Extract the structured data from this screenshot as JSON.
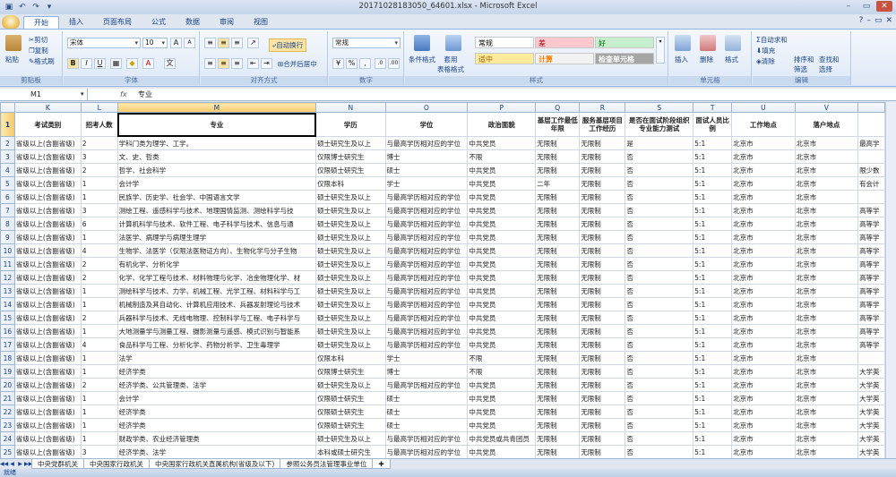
{
  "window": {
    "title": "20171028183050_64601.xlsx - Microsoft Excel"
  },
  "ribbon_tabs": [
    "开始",
    "插入",
    "页面布局",
    "公式",
    "数据",
    "审阅",
    "视图"
  ],
  "ribbon": {
    "clipboard": {
      "paste": "粘贴",
      "cut": "剪切",
      "copy": "复制",
      "format_painter": "格式刷",
      "label": "剪贴板"
    },
    "font": {
      "name": "宋体",
      "size": "10",
      "label": "字体"
    },
    "alignment": {
      "wrap": "自动换行",
      "merge": "合并后居中",
      "label": "对齐方式"
    },
    "number": {
      "format": "常规",
      "label": "数字"
    },
    "styles": {
      "conditional": "条件格式",
      "table_format": "套用\n表格格式",
      "boxes": [
        {
          "text": "常规",
          "bg": "#ffffff",
          "color": "#000000"
        },
        {
          "text": "差",
          "bg": "#ffc7ce",
          "color": "#9c0006"
        },
        {
          "text": "好",
          "bg": "#c6efce",
          "color": "#006100"
        },
        {
          "text": "适中",
          "bg": "#ffeb9c",
          "color": "#9c6500"
        },
        {
          "text": "计算",
          "bg": "#f2f2f2",
          "color": "#fa7d00"
        },
        {
          "text": "检查单元格",
          "bg": "#a5a5a5",
          "color": "#ffffff"
        }
      ],
      "label": "样式"
    },
    "cells": {
      "insert": "插入",
      "delete": "删除",
      "format": "格式",
      "label": "单元格"
    },
    "editing": {
      "autosum": "自动求和",
      "fill": "填充",
      "clear": "清除",
      "sort": "排序和\n筛选",
      "find": "查找和\n选择",
      "label": "编辑"
    }
  },
  "formula_bar": {
    "namebox": "M1",
    "fx": "fx",
    "content": "专业"
  },
  "columns": [
    "K",
    "L",
    "M",
    "N",
    "O",
    "P",
    "Q",
    "R",
    "S",
    "T",
    "U",
    "V",
    ""
  ],
  "header_row": [
    "考试类别",
    "招考人数",
    "专业",
    "学历",
    "学位",
    "政治面貌",
    "基层工作最低年限",
    "服务基层项目工作经历",
    "是否在面试阶段组织专业能力测试",
    "面试人员比例",
    "工作地点",
    "落户地点",
    ""
  ],
  "rows": [
    {
      "n": "2",
      "cells": [
        "省级以上(含副省级)",
        "2",
        "学科门类为理学、工学。",
        "硕士研究生及以上",
        "与最高学历相对应的学位",
        "中共党员",
        "无限制",
        "无限制",
        "是",
        "5:1",
        "北京市",
        "北京市",
        "最高学"
      ]
    },
    {
      "n": "3",
      "cells": [
        "省级以上(含副省级)",
        "3",
        "文、史、哲类",
        "仅限博士研究生",
        "博士",
        "不限",
        "无限制",
        "无限制",
        "否",
        "5:1",
        "北京市",
        "北京市",
        ""
      ]
    },
    {
      "n": "4",
      "cells": [
        "省级以上(含副省级)",
        "2",
        "哲学、社会科学",
        "仅限硕士研究生",
        "硕士",
        "中共党员",
        "无限制",
        "无限制",
        "否",
        "5:1",
        "北京市",
        "北京市",
        "限少数"
      ]
    },
    {
      "n": "5",
      "cells": [
        "省级以上(含副省级)",
        "1",
        "会计学",
        "仅限本科",
        "学士",
        "中共党员",
        "二年",
        "无限制",
        "否",
        "5:1",
        "北京市",
        "北京市",
        "有会计"
      ]
    },
    {
      "n": "6",
      "cells": [
        "省级以上(含副省级)",
        "1",
        "民族学、历史学、社会学、中国语言文学",
        "硕士研究生及以上",
        "与最高学历相对应的学位",
        "中共党员",
        "无限制",
        "无限制",
        "否",
        "5:1",
        "北京市",
        "北京市",
        ""
      ]
    },
    {
      "n": "7",
      "cells": [
        "省级以上(含副省级)",
        "3",
        "测绘工程、遥感科学与技术、地理国情监测、测绘科学与技",
        "硕士研究生及以上",
        "与最高学历相对应的学位",
        "中共党员",
        "无限制",
        "无限制",
        "否",
        "5:1",
        "北京市",
        "北京市",
        "高等学"
      ]
    },
    {
      "n": "8",
      "cells": [
        "省级以上(含副省级)",
        "6",
        "计算机科学与技术、软件工程、电子科学与技术、信息与通",
        "硕士研究生及以上",
        "与最高学历相对应的学位",
        "中共党员",
        "无限制",
        "无限制",
        "否",
        "5:1",
        "北京市",
        "北京市",
        "高等学"
      ]
    },
    {
      "n": "9",
      "cells": [
        "省级以上(含副省级)",
        "1",
        "法医学、病理学与病理生理学",
        "硕士研究生及以上",
        "与最高学历相对应的学位",
        "中共党员",
        "无限制",
        "无限制",
        "否",
        "5:1",
        "北京市",
        "北京市",
        "高等学"
      ]
    },
    {
      "n": "10",
      "cells": [
        "省级以上(含副省级)",
        "4",
        "生物学、法医学（仅限法医物证方向）、生物化学与分子生物",
        "硕士研究生及以上",
        "与最高学历相对应的学位",
        "中共党员",
        "无限制",
        "无限制",
        "否",
        "5:1",
        "北京市",
        "北京市",
        "高等学"
      ]
    },
    {
      "n": "11",
      "cells": [
        "省级以上(含副省级)",
        "2",
        "有机化学、分析化学",
        "硕士研究生及以上",
        "与最高学历相对应的学位",
        "中共党员",
        "无限制",
        "无限制",
        "否",
        "5:1",
        "北京市",
        "北京市",
        "高等学"
      ]
    },
    {
      "n": "12",
      "cells": [
        "省级以上(含副省级)",
        "2",
        "化学、化学工程与技术、材料物理与化学、冶金物理化学、材",
        "硕士研究生及以上",
        "与最高学历相对应的学位",
        "中共党员",
        "无限制",
        "无限制",
        "否",
        "5:1",
        "北京市",
        "北京市",
        "高等学"
      ]
    },
    {
      "n": "13",
      "cells": [
        "省级以上(含副省级)",
        "1",
        "测绘科学与技术、力学、机械工程、光学工程、材料科学与工",
        "硕士研究生及以上",
        "与最高学历相对应的学位",
        "中共党员",
        "无限制",
        "无限制",
        "否",
        "5:1",
        "北京市",
        "北京市",
        "高等学"
      ]
    },
    {
      "n": "14",
      "cells": [
        "省级以上(含副省级)",
        "1",
        "机械制造及其自动化、计算机应用技术、兵器发射理论与技术",
        "硕士研究生及以上",
        "与最高学历相对应的学位",
        "中共党员",
        "无限制",
        "无限制",
        "否",
        "5:1",
        "北京市",
        "北京市",
        "高等学"
      ]
    },
    {
      "n": "15",
      "cells": [
        "省级以上(含副省级)",
        "2",
        "兵器科学与技术、无线电物理、控制科学与工程、电子科学与",
        "硕士研究生及以上",
        "与最高学历相对应的学位",
        "中共党员",
        "无限制",
        "无限制",
        "否",
        "5:1",
        "北京市",
        "北京市",
        "高等学"
      ]
    },
    {
      "n": "16",
      "cells": [
        "省级以上(含副省级)",
        "1",
        "大地测量学与测量工程、摄影测量与遥感、模式识别与智能系",
        "硕士研究生及以上",
        "与最高学历相对应的学位",
        "中共党员",
        "无限制",
        "无限制",
        "否",
        "5:1",
        "北京市",
        "北京市",
        "高等学"
      ]
    },
    {
      "n": "17",
      "cells": [
        "省级以上(含副省级)",
        "4",
        "食品科学与工程、分析化学、药物分析学、卫生毒理学",
        "硕士研究生及以上",
        "与最高学历相对应的学位",
        "中共党员",
        "无限制",
        "无限制",
        "否",
        "5:1",
        "北京市",
        "北京市",
        "高等学"
      ]
    },
    {
      "n": "18",
      "cells": [
        "省级以上(含副省级)",
        "1",
        "法学",
        "仅限本科",
        "学士",
        "不限",
        "无限制",
        "无限制",
        "否",
        "5:1",
        "北京市",
        "北京市",
        ""
      ]
    },
    {
      "n": "19",
      "cells": [
        "省级以上(含副省级)",
        "1",
        "经济学类",
        "仅限博士研究生",
        "博士",
        "不限",
        "无限制",
        "无限制",
        "否",
        "5:1",
        "北京市",
        "北京市",
        "大学英"
      ]
    },
    {
      "n": "20",
      "cells": [
        "省级以上(含副省级)",
        "2",
        "经济学类、公共管理类、法学",
        "硕士研究生及以上",
        "与最高学历相对应的学位",
        "中共党员",
        "无限制",
        "无限制",
        "否",
        "5:1",
        "北京市",
        "北京市",
        "大学英"
      ]
    },
    {
      "n": "21",
      "cells": [
        "省级以上(含副省级)",
        "1",
        "会计学",
        "仅限硕士研究生",
        "硕士",
        "中共党员",
        "无限制",
        "无限制",
        "否",
        "5:1",
        "北京市",
        "北京市",
        "大学英"
      ]
    },
    {
      "n": "22",
      "cells": [
        "省级以上(含副省级)",
        "1",
        "经济学类",
        "仅限硕士研究生",
        "硕士",
        "中共党员",
        "无限制",
        "无限制",
        "否",
        "5:1",
        "北京市",
        "北京市",
        "大学英"
      ]
    },
    {
      "n": "23",
      "cells": [
        "省级以上(含副省级)",
        "1",
        "经济学类",
        "仅限硕士研究生",
        "硕士",
        "中共党员",
        "无限制",
        "无限制",
        "否",
        "5:1",
        "北京市",
        "北京市",
        "大学英"
      ]
    },
    {
      "n": "24",
      "cells": [
        "省级以上(含副省级)",
        "1",
        "财政学类、农业经济管理类",
        "硕士研究生及以上",
        "与最高学历相对应的学位",
        "中共党员或共青团员",
        "无限制",
        "无限制",
        "否",
        "5:1",
        "北京市",
        "北京市",
        "大学英"
      ]
    },
    {
      "n": "25",
      "cells": [
        "省级以上(含副省级)",
        "3",
        "经济学类、法学",
        "本科或硕士研究生",
        "与最高学历相对应的学位",
        "中共党员",
        "无限制",
        "无限制",
        "否",
        "5:1",
        "北京市",
        "北京市",
        "大学英"
      ]
    }
  ],
  "sheet_tabs": [
    "中央党群机关",
    "中央国家行政机关",
    "中央国家行政机关直属机构(省级及以下)",
    "参照公务员法管理事业单位"
  ],
  "status": "就绪"
}
